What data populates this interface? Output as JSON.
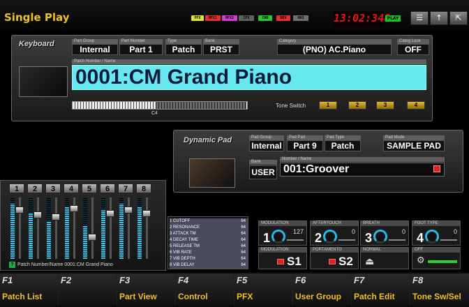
{
  "title": "Single Play",
  "indicators": [
    {
      "label": "PFX",
      "color": "#e0e030"
    },
    {
      "label": "MFX1",
      "color": "#e03030"
    },
    {
      "label": "MFX2",
      "color": "#d040d0"
    },
    {
      "label": "IFX",
      "color": "#606060"
    },
    {
      "label": "CHO",
      "color": "#30c030"
    },
    {
      "label": "REV",
      "color": "#e03030"
    },
    {
      "label": "MAS",
      "color": "#707070"
    }
  ],
  "clock": "13:02:348",
  "play_badge": "PLAY",
  "icons": {
    "menu": "menu-icon",
    "up": "up-arrow-icon",
    "exit": "exit-icon"
  },
  "keyboard": {
    "label": "Keyboard",
    "part_group_label": "Part Group",
    "part_group": "Internal",
    "part_number_label": "Part Number",
    "part_number": "Part 1",
    "type_label": "Type",
    "type": "Patch",
    "bank_label": "Bank",
    "bank": "PRST",
    "category_label": "Category",
    "category": "(PNO) AC.Piano",
    "categ_lock_label": "Categ Lock",
    "categ_lock": "OFF",
    "patch_name_label": "Patch Number / Name",
    "patch_name": "0001:CM Grand Piano",
    "key_marker": "C4",
    "tone_switch_label": "Tone Switch",
    "tone_switches": [
      "1",
      "2",
      "3",
      "4"
    ]
  },
  "dynamic_pad": {
    "label": "Dynamic Pad",
    "pad_group_label": "Pad Group",
    "pad_group": "Internal",
    "pad_part_label": "Pad Part",
    "pad_part": "Part 9",
    "pad_type_label": "Pad Type",
    "pad_type": "Patch",
    "pad_mode_label": "Pad Mode",
    "pad_mode": "SAMPLE PAD",
    "bank_label": "Bank",
    "bank": "USER",
    "name_label": "Number / Name",
    "name": "001:Groover"
  },
  "mixer": {
    "channels": [
      "1",
      "2",
      "3",
      "4",
      "5",
      "6",
      "7",
      "8"
    ],
    "levels": [
      0.9,
      0.75,
      0.6,
      0.85,
      0.55,
      0.8,
      0.9,
      0.85
    ],
    "faders": [
      0.8,
      0.72,
      0.68,
      0.82,
      0.35,
      0.74,
      0.8,
      0.74
    ],
    "status": "Patch Number/Name 0001:CM Grand Piano"
  },
  "controls": [
    {
      "label": "1 CUTOFF",
      "value": "64"
    },
    {
      "label": "2 RESONANCE",
      "value": "64"
    },
    {
      "label": "3 ATTACK TM",
      "value": "64"
    },
    {
      "label": "4 DECAY TIME",
      "value": "64"
    },
    {
      "label": "5 RELEASE TM",
      "value": "64"
    },
    {
      "label": "6 VIB RATE",
      "value": "64"
    },
    {
      "label": "7 VIB DEPTH",
      "value": "64"
    },
    {
      "label": "8 VIB DELAY",
      "value": "64"
    }
  ],
  "assign_knobs": [
    {
      "label": "MODULATION",
      "num": "1",
      "value": "127"
    },
    {
      "label": "AFTERTOUCH",
      "num": "2",
      "value": "0"
    },
    {
      "label": "BREATH",
      "num": "3",
      "value": "0"
    },
    {
      "label": "FOOT TYPE",
      "num": "4",
      "value": "0"
    }
  ],
  "assign_switches": [
    {
      "label": "MODULATION",
      "text": "S1"
    },
    {
      "label": "PORTAMENTO",
      "text": "S2"
    },
    {
      "label": "NORMAL",
      "text": ""
    },
    {
      "label": "OFF",
      "text": ""
    }
  ],
  "function_keys": [
    {
      "num": "F1",
      "label": "Patch List"
    },
    {
      "num": "F2",
      "label": ""
    },
    {
      "num": "F3",
      "label": "Part View"
    },
    {
      "num": "F4",
      "label": "Control"
    },
    {
      "num": "F5",
      "label": "PFX"
    },
    {
      "num": "F6",
      "label": "User Group"
    },
    {
      "num": "F7",
      "label": "Patch Edit"
    },
    {
      "num": "F8",
      "label": "Tone Sw/Sel"
    }
  ]
}
